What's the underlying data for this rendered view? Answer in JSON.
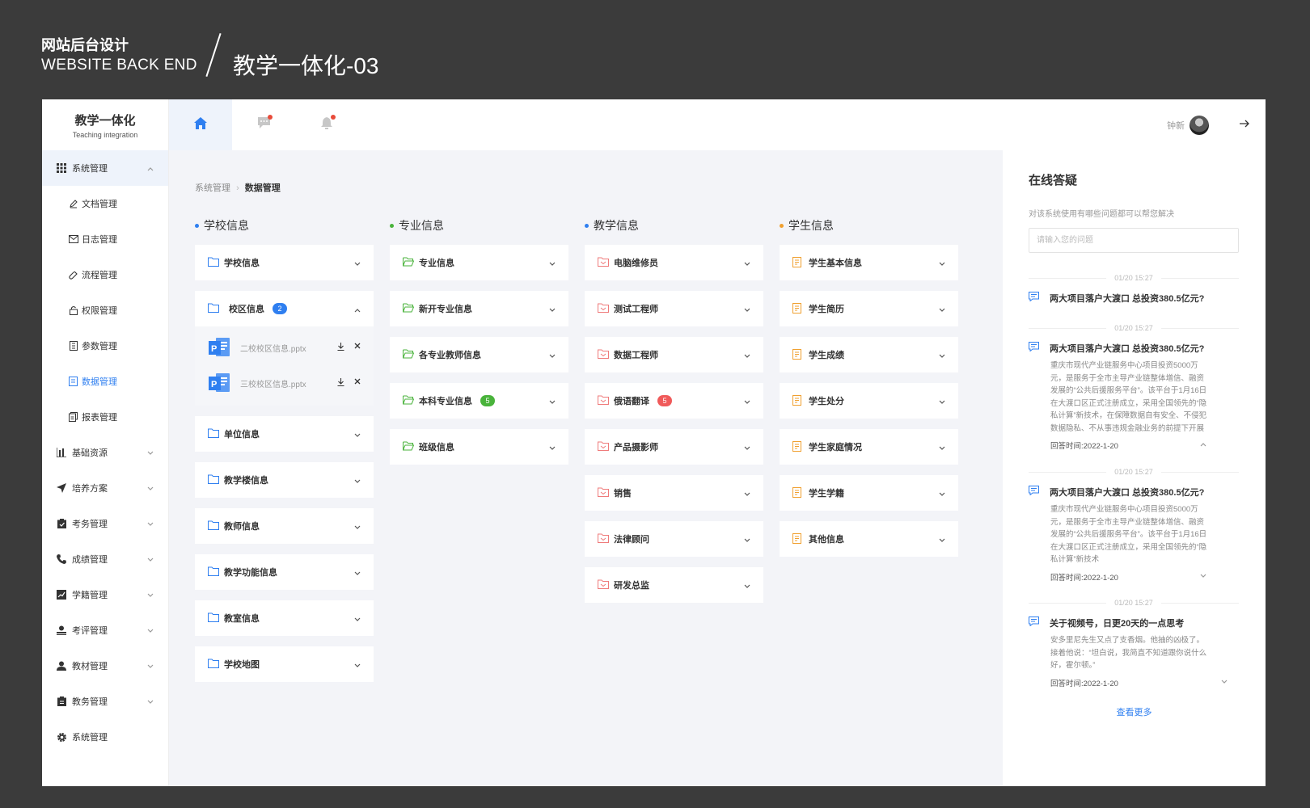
{
  "banner": {
    "line1": "网站后台设计",
    "line2": "WEBSITE BACK END",
    "title": "教学一体化-03"
  },
  "brand": {
    "title": "教学一体化",
    "subtitle": "Teaching integration"
  },
  "sidebar": {
    "open_group": {
      "label": "系统管理",
      "icon": "grid-icon"
    },
    "sub_items": [
      {
        "label": "文档管理",
        "icon": "pen-icon"
      },
      {
        "label": "日志管理",
        "icon": "mail-icon"
      },
      {
        "label": "流程管理",
        "icon": "link-icon"
      },
      {
        "label": "权限管理",
        "icon": "lock-icon"
      },
      {
        "label": "参数管理",
        "icon": "doc-icon"
      },
      {
        "label": "数据管理",
        "icon": "data-icon",
        "active": true
      },
      {
        "label": "报表管理",
        "icon": "report-icon"
      }
    ],
    "groups": [
      {
        "label": "基础资源",
        "icon": "chart-icon"
      },
      {
        "label": "培养方案",
        "icon": "send-icon"
      },
      {
        "label": "考务管理",
        "icon": "clipboard-icon"
      },
      {
        "label": "成绩管理",
        "icon": "phone-icon"
      },
      {
        "label": "学籍管理",
        "icon": "trend-icon"
      },
      {
        "label": "考评管理",
        "icon": "user-icon"
      },
      {
        "label": "教材管理",
        "icon": "person-icon"
      },
      {
        "label": "教务管理",
        "icon": "clipboard-icon"
      },
      {
        "label": "系统管理",
        "icon": "gear-icon"
      }
    ]
  },
  "header": {
    "user_name": "钟新"
  },
  "breadcrumb": {
    "parent": "系统管理",
    "current": "数据管理"
  },
  "columns": [
    {
      "title": "学校信息",
      "color": "#2f7ff0",
      "icon_color": "#2f7ff0",
      "items": [
        {
          "label": "学校信息"
        },
        {
          "label": "校区信息",
          "badge": "2",
          "badge_color": "#2f7ff0",
          "expanded": true,
          "files": [
            "二校校区信息.pptx",
            "三校校区信息.pptx"
          ]
        },
        {
          "label": "单位信息"
        },
        {
          "label": "教学楼信息"
        },
        {
          "label": "教师信息"
        },
        {
          "label": "教学功能信息"
        },
        {
          "label": "教室信息"
        },
        {
          "label": "学校地图"
        }
      ]
    },
    {
      "title": "专业信息",
      "color": "#49b33b",
      "icon_color": "#49b33b",
      "items": [
        {
          "label": "专业信息"
        },
        {
          "label": "新开专业信息"
        },
        {
          "label": "各专业教师信息"
        },
        {
          "label": "本科专业信息",
          "badge": "5",
          "badge_color": "#49b33b"
        },
        {
          "label": "班级信息"
        }
      ]
    },
    {
      "title": "教学信息",
      "color": "#2f7ff0",
      "icon_color": "#ef7b7b",
      "items": [
        {
          "label": "电脑维修员"
        },
        {
          "label": "测试工程师"
        },
        {
          "label": "数据工程师"
        },
        {
          "label": "俄语翻译",
          "badge": "5",
          "badge_color": "#f05a5a"
        },
        {
          "label": "产品摄影师"
        },
        {
          "label": "销售"
        },
        {
          "label": "法律顾问"
        },
        {
          "label": "研发总监"
        }
      ]
    },
    {
      "title": "学生信息",
      "color": "#f0a030",
      "icon_color": "#f0a030",
      "items": [
        {
          "label": "学生基本信息"
        },
        {
          "label": "学生简历"
        },
        {
          "label": "学生成绩"
        },
        {
          "label": "学生处分"
        },
        {
          "label": "学生家庭情况"
        },
        {
          "label": "学生学籍"
        },
        {
          "label": "其他信息"
        }
      ]
    }
  ],
  "qa": {
    "title": "在线答疑",
    "subtitle": "对该系统使用有哪些问题都可以帮您解决",
    "placeholder": "请输入您的问题",
    "items": [
      {
        "time": "01/20 15:27",
        "question": "两大项目落户大渡口 总投资380.5亿元?"
      },
      {
        "time": "01/20 15:27",
        "question": "两大项目落户大渡口 总投资380.5亿元?",
        "answer": "重庆市现代产业链服务中心项目投资5000万元，是服务于全市主导产业链整体增信、融资发展的“公共后援服务平台”。该平台于1月16日在大渡口区正式注册成立，采用全国领先的“隐私计算”新技术，在保障数据自有安全、不侵犯数据隐私、不从事违规金融业务的前提下开展",
        "meta": "回答时间:2022-1-20",
        "expanded": true
      },
      {
        "time": "01/20 15:27",
        "question": "两大项目落户大渡口 总投资380.5亿元?",
        "answer": "重庆市现代产业链服务中心项目投资5000万元，是服务于全市主导产业链整体增信、融资发展的“公共后援服务平台”。该平台于1月16日在大渡口区正式注册成立，采用全国领先的“隐私计算”新技术",
        "meta": "回答时间:2022-1-20"
      },
      {
        "time": "01/20 15:27",
        "question": "关于视频号，日更20天的一点思考",
        "answer": "安多里尼先生又点了支香烟。他抽的凶极了。接着他说：“坦白说，我简直不知道跟你说什么好，霍尔顿。”",
        "meta": "回答时间:2022-1-20"
      }
    ],
    "more": "查看更多"
  }
}
